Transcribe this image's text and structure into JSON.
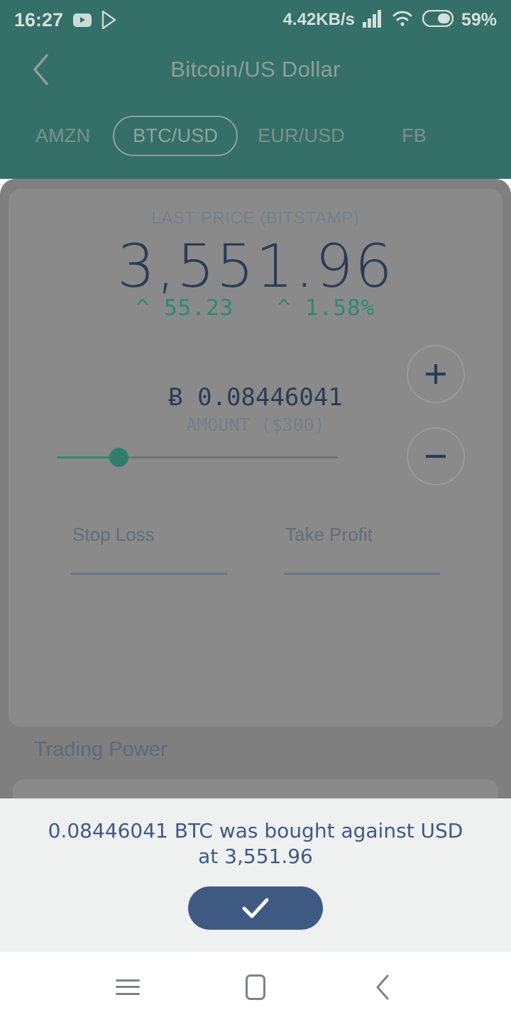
{
  "status_bar": {
    "time": "16:27",
    "network_speed": "4.42KB/s",
    "battery_percent": "59%",
    "icons": [
      "youtube-icon",
      "play-store-icon",
      "signal-icon",
      "wifi-icon",
      "battery-icon"
    ]
  },
  "header": {
    "back_label": "back-chevron",
    "title": "Bitcoin/US Dollar"
  },
  "tabs": [
    {
      "label": "AMZN",
      "selected": false
    },
    {
      "label": "BTC/USD",
      "selected": true
    },
    {
      "label": "EUR/USD",
      "selected": false
    },
    {
      "label": "FB",
      "selected": false
    }
  ],
  "quote": {
    "price_label": "LAST PRICE (BITSTAMP)",
    "price_value": "3,551.96",
    "change_absolute": "55.23",
    "change_percent": "1.58%",
    "change_arrow": "^",
    "change_direction": "up"
  },
  "order": {
    "amount_value": "Ƀ 0.08446041",
    "amount_label": "AMOUNT ($300)",
    "increase_label": "+",
    "decrease_label": "−",
    "slider_percent": 22,
    "stop_loss_placeholder": "Stop Loss",
    "stop_loss_value": "",
    "take_profit_placeholder": "Take Profit",
    "take_profit_value": ""
  },
  "section": {
    "trading_power_label": "Trading Power"
  },
  "confirmation": {
    "message": "0.08446041 BTC was bought against USD at 3,551.96",
    "confirm_icon": "check-icon"
  },
  "nav_bar": {
    "recents_label": "recents-button",
    "home_label": "home-button",
    "back_label": "back-button"
  },
  "colors": {
    "header_teal": "#347067",
    "scrim_gray": "#8a8a8a",
    "price_navy": "#2b3c57",
    "accent_green": "#2d8a6f",
    "confirm_navy": "#3e5a83",
    "sheet_bg": "#eff0f0"
  }
}
